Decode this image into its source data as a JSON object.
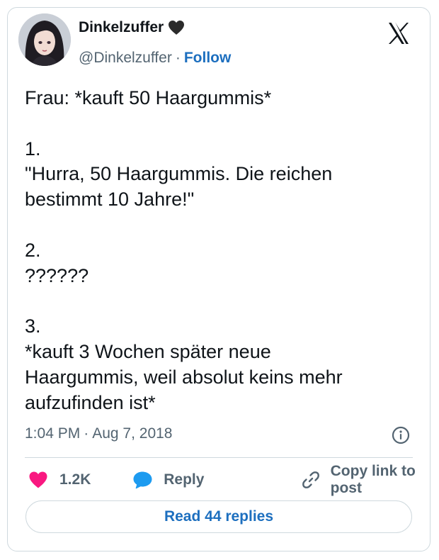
{
  "author": {
    "display_name": "Dinkelzuffer",
    "handle": "@Dinkelzuffer",
    "separator": "·",
    "follow_label": "Follow",
    "badge_icon": "black-heart-icon"
  },
  "tweet": {
    "text": "Frau: *kauft 50 Haargummis*\n\n1.\n\"Hurra, 50 Haargummis. Die reichen\nbestimmt 10 Jahre!\"\n\n2.\n??????\n\n3.\n*kauft 3 Wochen später neue\nHaargummis, weil absolut keins mehr\naufzufinden ist*",
    "time": "1:04 PM",
    "separator": "·",
    "date": "Aug 7, 2018"
  },
  "actions": {
    "like_count": "1.2K",
    "reply_label": "Reply",
    "copy_link_label": "Copy link to post"
  },
  "footer": {
    "read_replies_label": "Read 44 replies"
  },
  "colors": {
    "like": "#f91880",
    "reply": "#1d9bf0",
    "link": "#1d6fbf",
    "muted": "#536471",
    "border": "#cfd9de"
  }
}
